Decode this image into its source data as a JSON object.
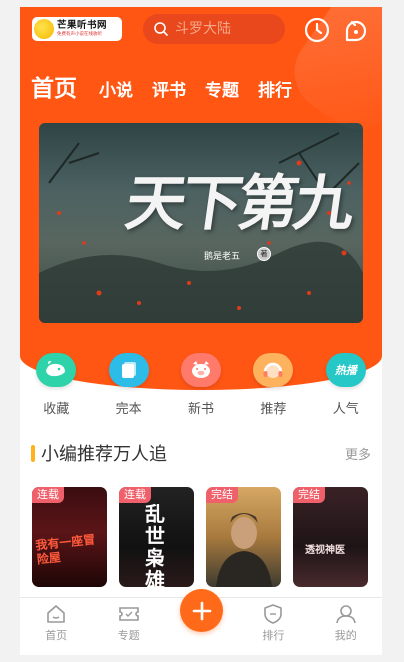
{
  "app": {
    "logo_name": "芒果听书网",
    "logo_slogan": "免费有声小说在线收听"
  },
  "search": {
    "placeholder": "斗罗大陆"
  },
  "header": {
    "icons": [
      "clock-icon",
      "menu-bubble-icon"
    ]
  },
  "tabs": [
    {
      "label": "首页",
      "active": true
    },
    {
      "label": "小说"
    },
    {
      "label": "评书"
    },
    {
      "label": "专题"
    },
    {
      "label": "排行"
    }
  ],
  "banner": {
    "title": "天下第九",
    "author": "鹅是老五",
    "stamp": "著"
  },
  "categories": [
    {
      "label": "收藏",
      "icon": "whale-icon",
      "color": "#2ed3a9"
    },
    {
      "label": "完本",
      "icon": "cards-icon",
      "color": "#2dbbe8"
    },
    {
      "label": "新书",
      "icon": "pig-icon",
      "color": "#ff7a6b"
    },
    {
      "label": "推荐",
      "icon": "headphones-icon",
      "color": "#ffb25e"
    },
    {
      "label": "人气",
      "icon": "hot-text-icon",
      "color": "#25c7c7",
      "text": "热播"
    }
  ],
  "section": {
    "title": "小编推荐万人追",
    "more": "更多"
  },
  "books": [
    {
      "badge": "连载",
      "cover_text": "我有一座冒险屋"
    },
    {
      "badge": "连载",
      "cover_text": "乱世枭雄"
    },
    {
      "badge": "完结",
      "cover_text": ""
    },
    {
      "badge": "完结",
      "cover_text": "透视神医"
    }
  ],
  "nav": [
    {
      "label": "首页",
      "icon": "home-icon"
    },
    {
      "label": "专题",
      "icon": "ticket-icon"
    },
    {
      "label": "",
      "icon": "plus-icon"
    },
    {
      "label": "排行",
      "icon": "shield-icon"
    },
    {
      "label": "我的",
      "icon": "user-icon"
    }
  ],
  "colors": {
    "brand": "#ff5614",
    "accent": "#ffb21a",
    "badge": "#f0606a"
  }
}
